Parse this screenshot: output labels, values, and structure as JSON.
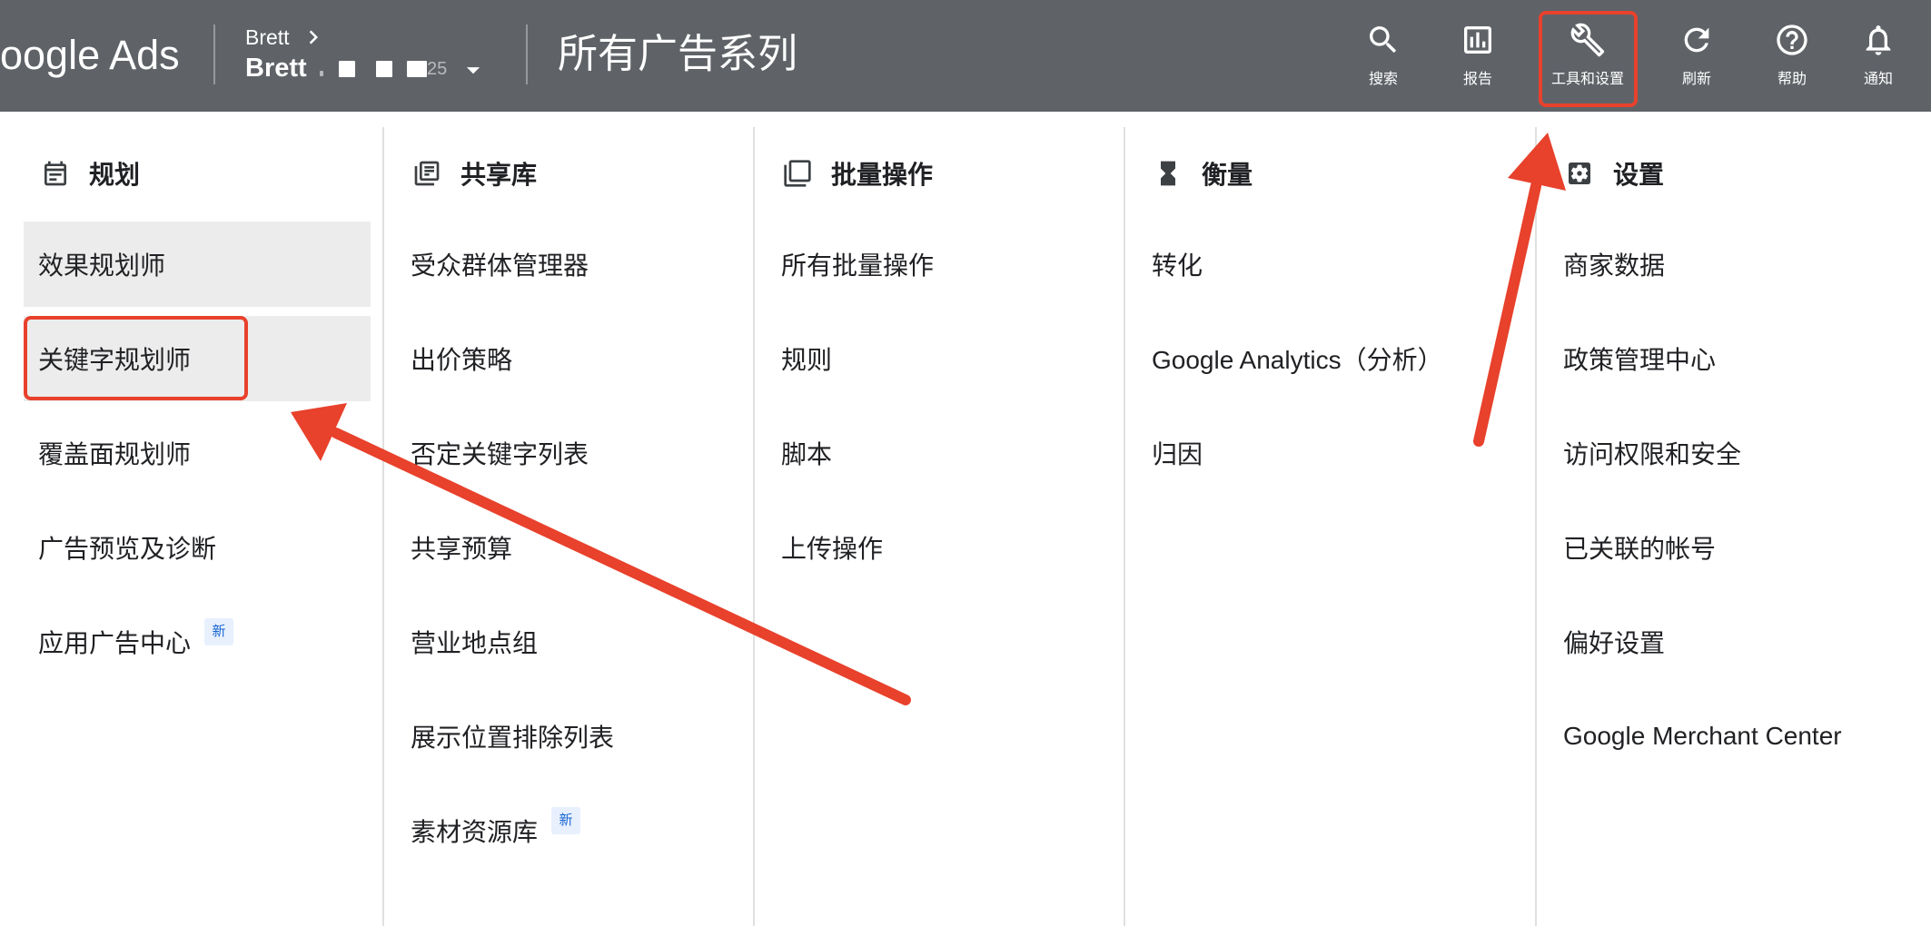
{
  "colors": {
    "header-bg": "#5f6368",
    "highlight-bg": "#ececec",
    "annotation-red": "#e8412c",
    "badge-bg": "#e8f0fe",
    "badge-text": "#1967d2"
  },
  "header": {
    "logo_text": "oogle Ads",
    "breadcrumb": {
      "parent": "Brett",
      "account": "Brett",
      "account_suffix": "25"
    },
    "page_title": "所有广告系列",
    "toolbar": [
      {
        "label": "搜索",
        "icon": "search-icon"
      },
      {
        "label": "报告",
        "icon": "bar-chart-icon"
      },
      {
        "label": "工具和设置",
        "icon": "wrench-icon",
        "highlighted": true
      },
      {
        "label": "刷新",
        "icon": "refresh-icon"
      },
      {
        "label": "帮助",
        "icon": "help-icon"
      },
      {
        "label": "通知",
        "icon": "bell-icon"
      }
    ]
  },
  "menu": {
    "columns": [
      {
        "heading": "规划",
        "icon": "calendar-icon",
        "items": [
          {
            "label": "效果规划师",
            "highlighted": true
          },
          {
            "label": "关键字规划师",
            "highlighted": true,
            "annotated": true
          },
          {
            "label": "覆盖面规划师"
          },
          {
            "label": "广告预览及诊断"
          },
          {
            "label": "应用广告中心",
            "badge": "新"
          }
        ]
      },
      {
        "heading": "共享库",
        "icon": "library-icon",
        "items": [
          {
            "label": "受众群体管理器"
          },
          {
            "label": "出价策略"
          },
          {
            "label": "否定关键字列表"
          },
          {
            "label": "共享预算"
          },
          {
            "label": "营业地点组"
          },
          {
            "label": "展示位置排除列表"
          },
          {
            "label": "素材资源库",
            "badge": "新"
          }
        ]
      },
      {
        "heading": "批量操作",
        "icon": "copy-icon",
        "items": [
          {
            "label": "所有批量操作"
          },
          {
            "label": "规则"
          },
          {
            "label": "脚本"
          },
          {
            "label": "上传操作"
          }
        ]
      },
      {
        "heading": "衡量",
        "icon": "hourglass-icon",
        "items": [
          {
            "label": "转化"
          },
          {
            "label": "Google Analytics（分析）"
          },
          {
            "label": "归因"
          }
        ]
      },
      {
        "heading": "设置",
        "icon": "settings-icon",
        "items": [
          {
            "label": "商家数据"
          },
          {
            "label": "政策管理中心"
          },
          {
            "label": "访问权限和安全"
          },
          {
            "label": "已关联的帐号"
          },
          {
            "label": "偏好设置"
          },
          {
            "label": "Google Merchant Center"
          }
        ]
      }
    ]
  }
}
